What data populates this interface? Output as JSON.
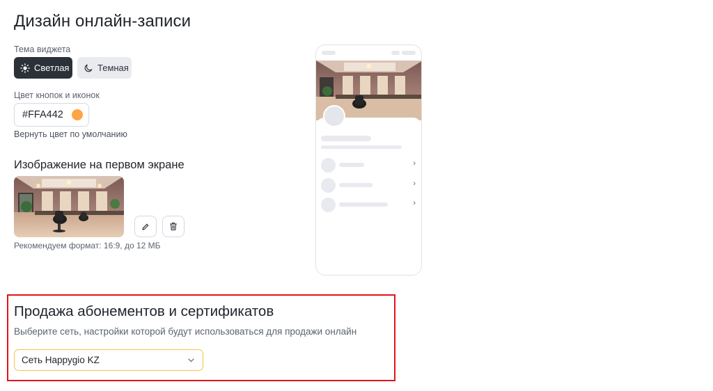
{
  "page": {
    "title": "Дизайн онлайн-записи"
  },
  "theme": {
    "label": "Тема виджета",
    "options": [
      {
        "label": "Светлая",
        "icon": "sun-icon",
        "selected": true
      },
      {
        "label": "Темная",
        "icon": "moon-icon",
        "selected": false
      }
    ]
  },
  "color": {
    "label": "Цвет кнопок и иконок",
    "value": "#FFA442",
    "swatch": "#FFA442",
    "reset_link": "Вернуть цвет по умолчанию"
  },
  "image": {
    "heading": "Изображение на первом экране",
    "edit_icon": "pencil-icon",
    "delete_icon": "trash-icon",
    "hint": "Рекомендуем формат: 16:9, до 12 МБ"
  },
  "sales": {
    "title": "Продажа абонементов и сертификатов",
    "description": "Выберите сеть, настройки которой будут использоваться для продажи онлайн",
    "select_value": "Сеть Happygio KZ",
    "highlight_color": "#e0141b"
  }
}
